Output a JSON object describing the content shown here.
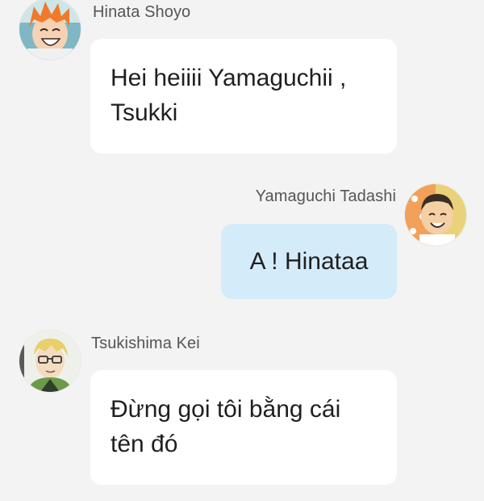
{
  "messages": [
    {
      "sender": "Hinata Shoyo",
      "direction": "incoming",
      "avatar_icon": "hinata-avatar-icon",
      "text": "Hei heiiii Yamaguchii ,\nTsukki"
    },
    {
      "sender": "Yamaguchi Tadashi",
      "direction": "outgoing",
      "avatar_icon": "yamaguchi-avatar-icon",
      "text": "A ! Hinataa"
    },
    {
      "sender": "Tsukishima Kei",
      "direction": "incoming",
      "avatar_icon": "tsukishima-avatar-icon",
      "text": "Đừng gọi tôi bằng cái\ntên đó"
    }
  ],
  "colors": {
    "background": "#f3f3f3",
    "incoming_bubble": "#ffffff",
    "outgoing_bubble": "#d4ebfa",
    "name_text": "#555555",
    "message_text": "#1f1f1f"
  }
}
